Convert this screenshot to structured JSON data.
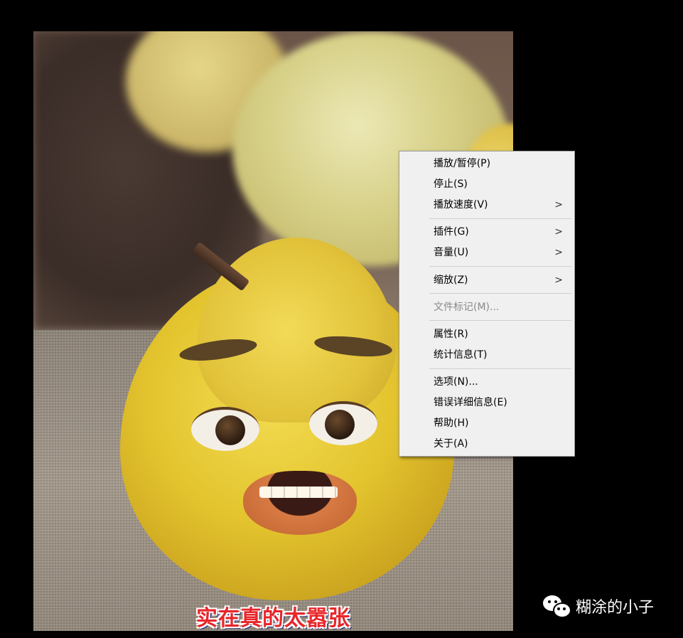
{
  "video": {
    "subtitle": "实在真的太嚣张"
  },
  "context_menu": {
    "items": [
      {
        "label": "播放/暂停(P)",
        "submenu": false,
        "disabled": false
      },
      {
        "label": "停止(S)",
        "submenu": false,
        "disabled": false
      },
      {
        "label": "播放速度(V)",
        "submenu": true,
        "disabled": false
      },
      {
        "label": "插件(G)",
        "submenu": true,
        "disabled": false
      },
      {
        "label": "音量(U)",
        "submenu": true,
        "disabled": false
      },
      {
        "label": "缩放(Z)",
        "submenu": true,
        "disabled": false
      },
      {
        "label": "文件标记(M)...",
        "submenu": false,
        "disabled": true
      },
      {
        "label": "属性(R)",
        "submenu": false,
        "disabled": false
      },
      {
        "label": "统计信息(T)",
        "submenu": false,
        "disabled": false
      },
      {
        "label": "选项(N)...",
        "submenu": false,
        "disabled": false
      },
      {
        "label": "错误详细信息(E)",
        "submenu": false,
        "disabled": false
      },
      {
        "label": "帮助(H)",
        "submenu": false,
        "disabled": false
      },
      {
        "label": "关于(A)",
        "submenu": false,
        "disabled": false
      }
    ],
    "submenu_arrow": ">"
  },
  "watermark": {
    "icon": "wechat-icon",
    "text": "糊涂的小子"
  },
  "colors": {
    "menu_bg": "#f0f0f0",
    "disabled_text": "#8a8a8a",
    "page_bg": "#000000"
  }
}
